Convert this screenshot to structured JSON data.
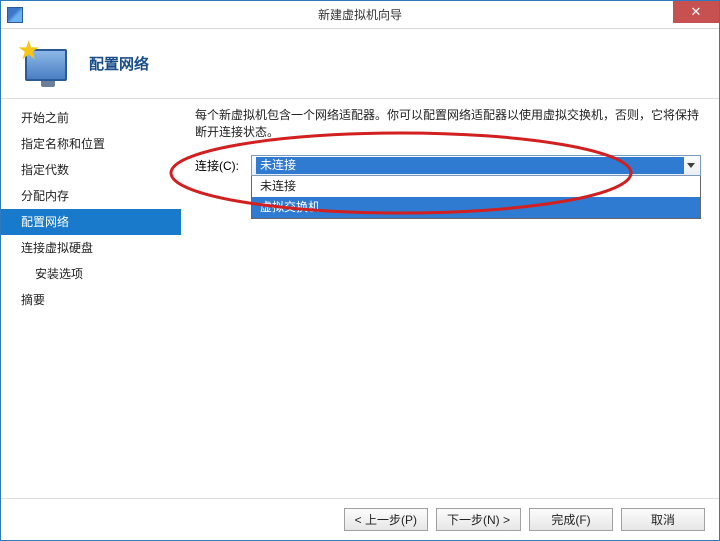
{
  "window": {
    "title": "新建虚拟机向导"
  },
  "header": {
    "title": "配置网络"
  },
  "sidebar": {
    "items": [
      {
        "label": "开始之前",
        "selected": false,
        "sub": false
      },
      {
        "label": "指定名称和位置",
        "selected": false,
        "sub": false
      },
      {
        "label": "指定代数",
        "selected": false,
        "sub": false
      },
      {
        "label": "分配内存",
        "selected": false,
        "sub": false
      },
      {
        "label": "配置网络",
        "selected": true,
        "sub": false
      },
      {
        "label": "连接虚拟硬盘",
        "selected": false,
        "sub": false
      },
      {
        "label": "安装选项",
        "selected": false,
        "sub": true
      },
      {
        "label": "摘要",
        "selected": false,
        "sub": false
      }
    ]
  },
  "content": {
    "description": "每个新虚拟机包含一个网络适配器。你可以配置网络适配器以使用虚拟交换机，否则，它将保持断开连接状态。",
    "connect_label": "连接(C):",
    "combo_selected": "未连接",
    "dropdown": [
      {
        "label": "未连接",
        "hover": false
      },
      {
        "label": "虚拟交换机",
        "hover": true
      }
    ]
  },
  "footer": {
    "prev": "< 上一步(P)",
    "next": "下一步(N) >",
    "finish": "完成(F)",
    "cancel": "取消"
  },
  "annotation": {
    "ellipse_color": "#d21f1f"
  }
}
